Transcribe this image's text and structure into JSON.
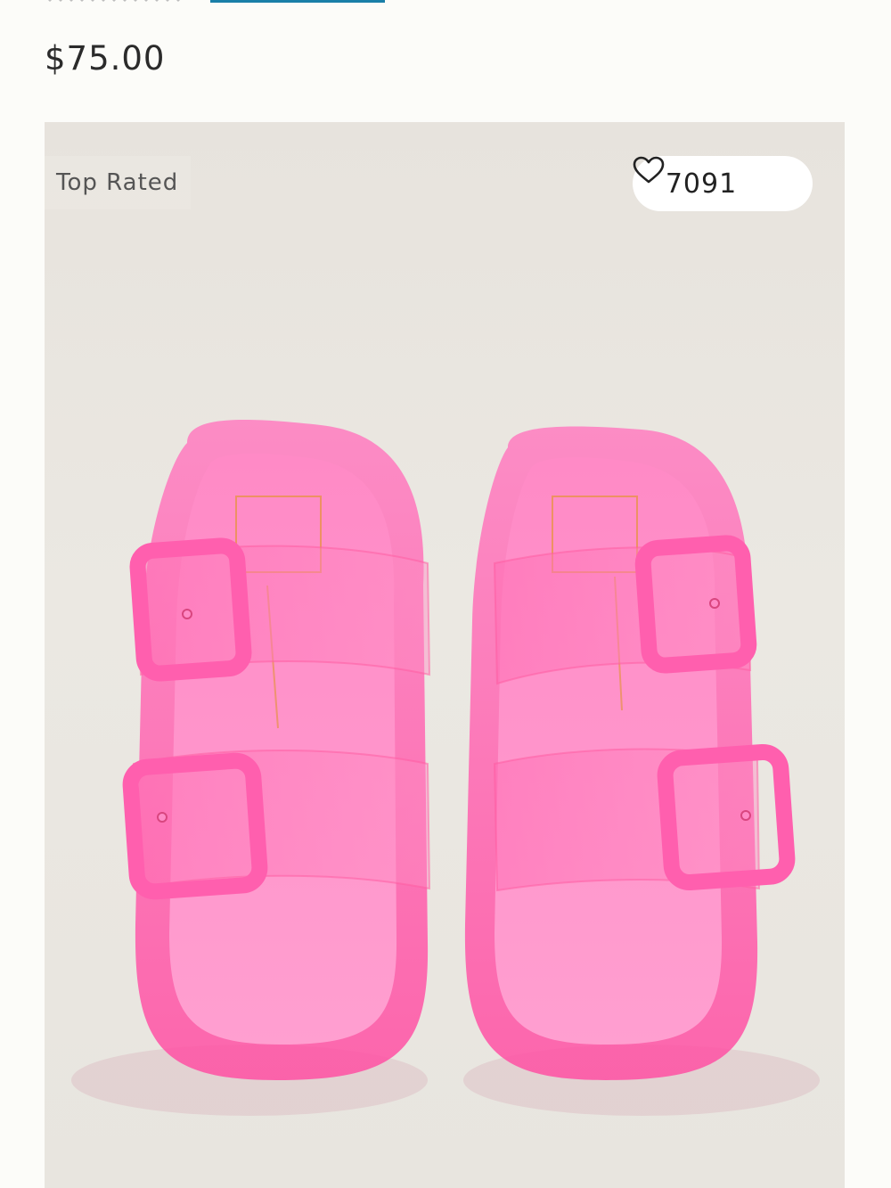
{
  "product": {
    "price": "$75.00",
    "image_alt": "Pink translucent double-buckle jelly slide sandals",
    "badge": "Top Rated",
    "likes": "7091"
  },
  "icons": {
    "like": "heart-outline-icon"
  },
  "colors": {
    "link_accent": "#1a7fa8",
    "sandal_pink": "#ff5fae",
    "background": "#e9e6e0"
  }
}
